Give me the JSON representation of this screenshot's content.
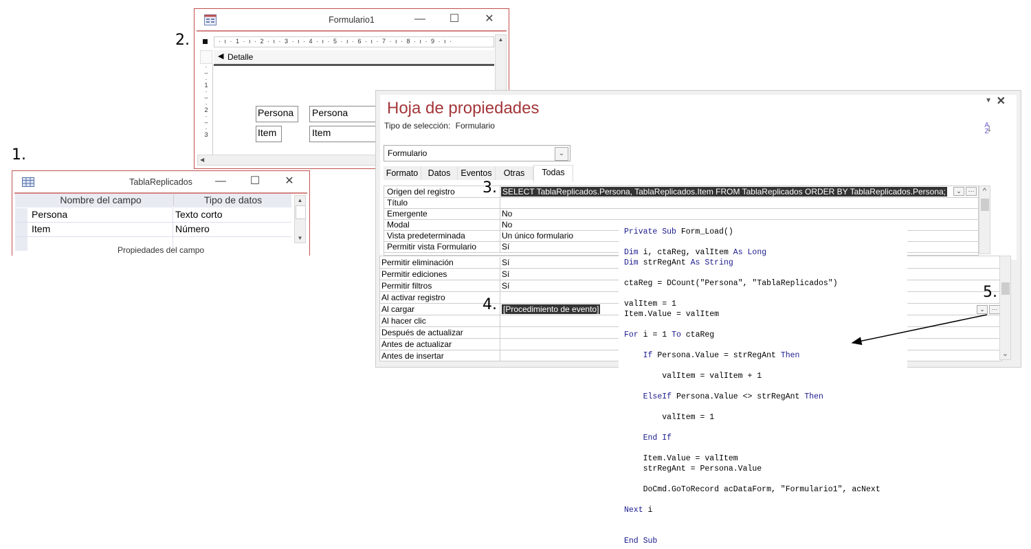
{
  "annotations": {
    "n1": "1.",
    "n2": "2.",
    "n3": "3.",
    "n4": "4.",
    "n5": "5."
  },
  "table_window": {
    "title": "TablaReplicados",
    "icon": "table-icon",
    "columns": [
      "Nombre del campo",
      "Tipo de datos"
    ],
    "rows": [
      {
        "field": "Persona",
        "type": "Texto corto"
      },
      {
        "field": "Item",
        "type": "Número"
      }
    ],
    "footer": "Propiedades del campo",
    "controls": {
      "minimize": "—",
      "maximize": "☐",
      "close": "✕"
    }
  },
  "form_window": {
    "title": "Formulario1",
    "icon": "form-icon",
    "ruler_top": "· ı · 1 · ı · 2 · ı · 3 · ı · 4 · ı · 5 · ı · 6 · ı · 7 · ı · 8 · ı · 9 · ı ·",
    "ruler_left": [
      "·",
      "–",
      "·",
      "1",
      "·",
      "–",
      "·",
      "2",
      "·",
      "–",
      "·",
      "3"
    ],
    "section": "Detalle",
    "labels": [
      "Persona",
      "Item"
    ],
    "textboxes": [
      "Persona",
      "Item"
    ],
    "controls": {
      "minimize": "—",
      "maximize": "☐",
      "close": "✕"
    }
  },
  "property_sheet": {
    "title": "Hoja de propiedades",
    "selection_type_label": "Tipo de selección:",
    "selection_type_value": "Formulario",
    "object_combo": "Formulario",
    "tabs": [
      "Formato",
      "Datos",
      "Eventos",
      "Otras",
      "Todas"
    ],
    "active_tab": "Todas",
    "sort_icon": "A↓Z",
    "properties_top": [
      {
        "name": "Origen del registro",
        "value": "SELECT TablaReplicados.Persona, TablaReplicados.Item FROM TablaReplicados ORDER BY TablaReplicados.Persona;"
      },
      {
        "name": "Título",
        "value": ""
      },
      {
        "name": "Emergente",
        "value": "No"
      },
      {
        "name": "Modal",
        "value": "No"
      },
      {
        "name": "Vista predeterminada",
        "value": "Un único formulario"
      },
      {
        "name": "Permitir vista Formulario",
        "value": "Sí"
      }
    ],
    "properties_bottom": [
      {
        "name": "Permitir eliminación",
        "value": "Sí"
      },
      {
        "name": "Permitir ediciones",
        "value": "Sí"
      },
      {
        "name": "Permitir filtros",
        "value": "Sí"
      },
      {
        "name": "Al activar registro",
        "value": ""
      },
      {
        "name": "Al cargar",
        "value": "[Procedimiento de evento]"
      },
      {
        "name": "Al hacer clic",
        "value": ""
      },
      {
        "name": "Después de actualizar",
        "value": ""
      },
      {
        "name": "Antes de actualizar",
        "value": ""
      },
      {
        "name": "Antes de insertar",
        "value": ""
      }
    ],
    "builder_button": "···",
    "dropdown_button": "⌄"
  },
  "code": {
    "lines": [
      "Private Sub Form_Load()",
      "",
      "Dim i, ctaReg, valItem As Long",
      "Dim strRegAnt As String",
      "",
      "ctaReg = DCount(\"Persona\", \"TablaReplicados\")",
      "",
      "valItem = 1",
      "Item.Value = valItem",
      "",
      "For i = 1 To ctaReg",
      "",
      "    If Persona.Value = strRegAnt Then",
      "",
      "        valItem = valItem + 1",
      "",
      "    ElseIf Persona.Value <> strRegAnt Then",
      "",
      "        valItem = 1",
      "",
      "    End If",
      "",
      "    Item.Value = valItem",
      "    strRegAnt = Persona.Value",
      "",
      "    DoCmd.GoToRecord acDataForm, \"Formulario1\", acNext",
      "",
      "Next i",
      "",
      "",
      "End Sub"
    ],
    "keywords": [
      "Private",
      "Sub",
      "Dim",
      "As",
      "Long",
      "String",
      "For",
      "To",
      "If",
      "Then",
      "ElseIf",
      "End",
      "Next"
    ]
  },
  "colors": {
    "accent": "#a4373a",
    "window_border": "#c0504d",
    "keyword": "#1a1a8c",
    "highlight_bg": "#333333"
  }
}
